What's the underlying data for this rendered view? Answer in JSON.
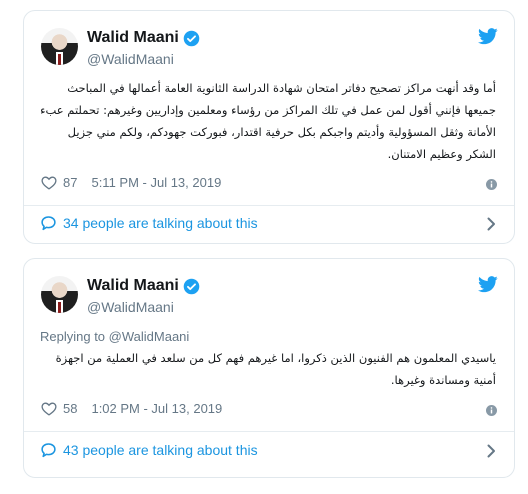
{
  "tweets": [
    {
      "author_name": "Walid Maani",
      "handle": "@WalidMaani",
      "replying_to": null,
      "text": "أما وقد أنهت مراكز تصحيح دفاتر امتحان شهادة الدراسة الثانوية العامة أعمالها في المباحث جميعها فإنني أقول لمن عمل في تلك المراكز من رؤساء ومعلمين وإداريين وغيرهم: تحملتم عبء الأمانة وثقل المسؤولية وأديتم واجبكم بكل حرفية اقتدار، فبوركت جهودكم، ولكم مني جزيل الشكر وعظيم الامتنان.",
      "likes": "87",
      "time": "5:11 PM - Jul 13, 2019",
      "talking": "34 people are talking about this"
    },
    {
      "author_name": "Walid Maani",
      "handle": "@WalidMaani",
      "replying_prefix": "Replying to",
      "replying_to": "@WalidMaani",
      "text": "ياسيدي المعلمون هم الفنيون الذين ذكروا، اما غيرهم فهم كل من سلعد في العملية من اجهزة أمنية ومساندة وغيرها.",
      "likes": "58",
      "time": "1:02 PM - Jul 13, 2019",
      "talking": "43 people are talking about this"
    }
  ],
  "colors": {
    "twitter_blue": "#1da1f2",
    "link_blue": "#1b95e0",
    "muted": "#657786",
    "border": "#e1e8ed"
  },
  "icons": [
    "twitter-bird-icon",
    "verified-badge-icon",
    "heart-icon",
    "info-icon",
    "speech-bubble-icon",
    "chevron-right-icon"
  ]
}
